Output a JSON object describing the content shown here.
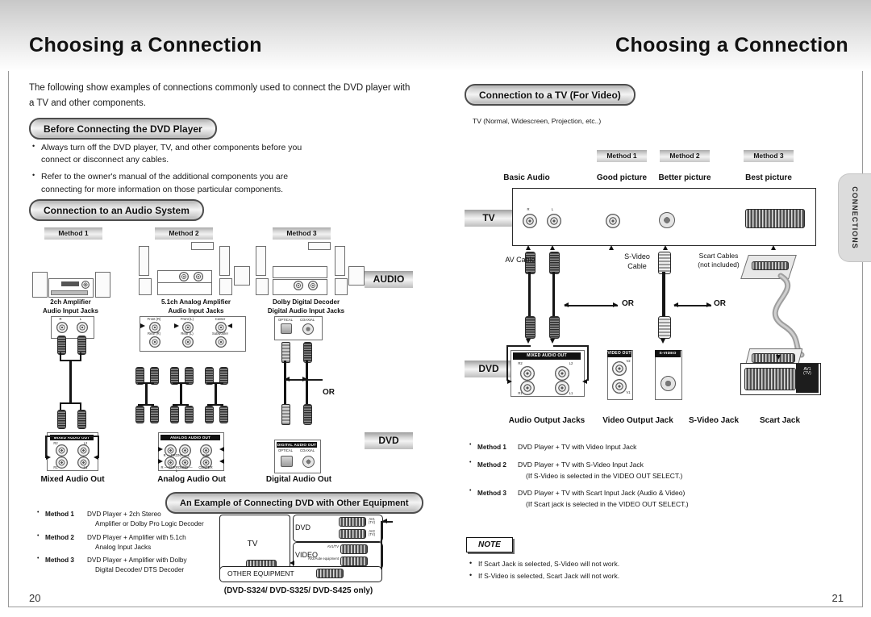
{
  "left_page": {
    "title": "Choosing a Connection",
    "page_number": "20",
    "intro": "The following show examples of connections commonly used to connect the DVD player with a TV and other components.",
    "section_before": "Before Connecting the DVD Player",
    "bullets": [
      "Always turn off the DVD player, TV, and other components before you connect or disconnect any cables.",
      "Refer to the owner's manual of the additional components you are connecting for more information on those particular components."
    ],
    "section_audio": "Connection to an Audio System",
    "methods": [
      "Method 1",
      "Method 2",
      "Method 3"
    ],
    "device_captions": [
      "2ch Amplifier\nAudio Input Jacks",
      "5.1ch Analog Amplifier\nAudio Input Jacks",
      "Dolby Digital Decoder\nDigital Audio Input Jacks"
    ],
    "badge_audio": "AUDIO",
    "badge_dvd": "DVD",
    "or_label": "OR",
    "out_captions": [
      "Mixed Audio Out",
      "Analog Audio Out",
      "Digital Audio Out"
    ],
    "jack_labels_m1": [
      "R",
      "L"
    ],
    "jack_labels_m2": [
      "Front (R)",
      "Front (L)",
      "Center",
      "Rear (R)",
      "Rear (L)",
      "Subwoofer"
    ],
    "jack_labels_m3": [
      "OPTICAL",
      "COAXIAL"
    ],
    "panel_mixed": "MIXED AUDIO OUT",
    "panel_mixed_jacks": [
      "R2",
      "L2",
      "R1",
      "L1"
    ],
    "panel_analog": "ANALOG AUDIO OUT",
    "panel_analog_jacks": [
      "R — FRONT — L",
      "R — SURROUND — L",
      "S.W",
      "CENTER"
    ],
    "panel_digital": "DIGITAL AUDIO OUT",
    "panel_digital_jacks": [
      "OPTICAL",
      "COAXIAL"
    ],
    "section_example": "An Example of Connecting DVD with Other Equipment",
    "example_methods": [
      {
        "name": "Method 1",
        "line1": "DVD Player + 2ch Stereo",
        "line2": "Amplifier or Dolby Pro Logic Decoder"
      },
      {
        "name": "Method 2",
        "line1": "DVD Player + Amplifier with 5.1ch",
        "line2": "Analog Input Jacks"
      },
      {
        "name": "Method 3",
        "line1": "DVD Player + Amplifier with Dolby",
        "line2": "Digital Decoder/ DTS Decoder"
      }
    ],
    "scart_diagram": {
      "tv": "TV",
      "dvd": "DVD",
      "video": "VIDEO",
      "other": "OTHER EQUIPMENT",
      "dvd_ports": [
        "AV1 (TV)",
        "AV2 (TV)"
      ],
      "video_ports": [
        "AV1/TV",
        "AV2/Aute equipment"
      ],
      "footnote": "(DVD-S324/ DVD-S325/ DVD-S425  only)"
    }
  },
  "right_page": {
    "title": "Choosing a Connection",
    "page_number": "21",
    "section_tv": "Connection to a TV (For Video)",
    "tv_note": "TV (Normal, Widescreen, Projection, etc..)",
    "methods": [
      "Method 1",
      "Method 2",
      "Method 3"
    ],
    "quality_labels": [
      "Basic Audio",
      "Good picture",
      "Better picture",
      "Best picture"
    ],
    "badge_tv": "TV",
    "badge_dvd": "DVD",
    "tv_jack_labels": [
      "R",
      "L"
    ],
    "cable_labels": [
      "AV Cable",
      "S-Video\nCable",
      "Scart Cables\n(not included)"
    ],
    "or_labels": [
      "OR",
      "OR"
    ],
    "dvd_panel_mixed": "MIXED AUDIO OUT",
    "dvd_panel_mixed_jacks": [
      "R2",
      "L2",
      "R1",
      "L1"
    ],
    "dvd_panel_video": "VIDEO OUT",
    "dvd_panel_video_jacks": [
      "V2",
      "V1"
    ],
    "dvd_panel_svideo": "S-VIDEO OUT",
    "scart_label": "AV1\n(TV)",
    "out_captions": [
      "Audio Output Jacks",
      "Video Output Jack",
      "S-Video Jack",
      "Scart Jack"
    ],
    "method_list": [
      {
        "name": "Method 1",
        "text": "DVD Player + TV with Video Input Jack",
        "sub": ""
      },
      {
        "name": "Method 2",
        "text": "DVD Player + TV with S-Video Input Jack",
        "sub": "(If S-Video is selected in the VIDEO OUT SELECT.)"
      },
      {
        "name": "Method 3",
        "text": "DVD Player + TV with Scart Input Jack (Audio & Video)",
        "sub": "(If Scart jack is selected in the VIDEO OUT SELECT.)"
      }
    ],
    "note_label": "NOTE",
    "note_bullets": [
      "If Scart Jack is selected, S-Video will not work.",
      "If S-Video is selected, Scart Jack will not work."
    ],
    "side_tab": "CONNECTIONS"
  }
}
